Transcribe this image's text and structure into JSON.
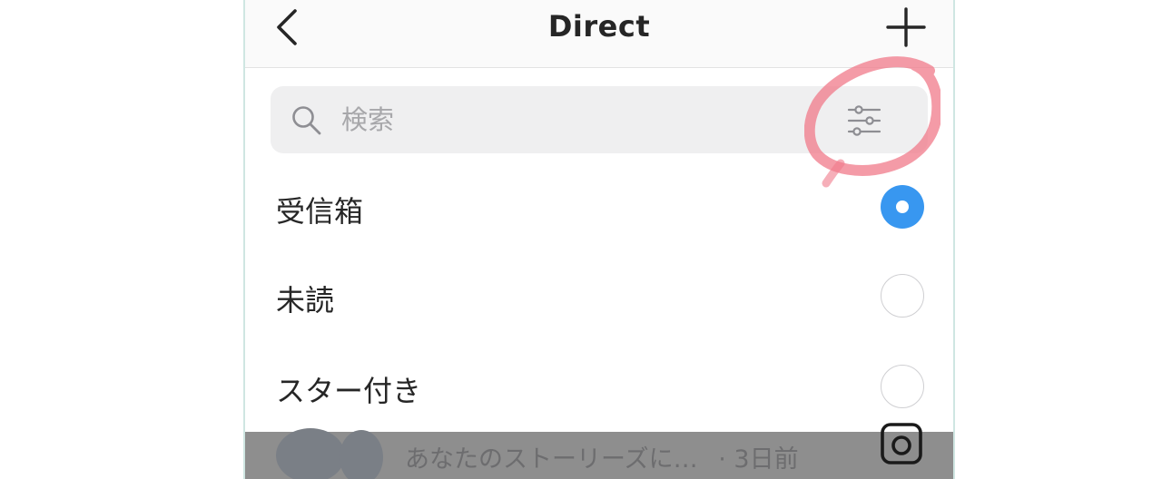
{
  "header": {
    "title": "Direct",
    "back_icon": "chevron-left-icon",
    "new_icon": "plus-icon"
  },
  "search": {
    "placeholder": "検索",
    "value": "",
    "search_icon": "search-icon",
    "filter_icon": "filter-sliders-icon"
  },
  "filters": [
    {
      "label": "受信箱",
      "selected": true
    },
    {
      "label": "未読",
      "selected": false
    },
    {
      "label": "スター付き",
      "selected": false
    }
  ],
  "background_preview": {
    "text": "あなたのストーリーズに…",
    "time": "· 3日前",
    "camera_icon": "camera-icon"
  },
  "colors": {
    "accent": "#3897f0",
    "highlight": "#f07a8a",
    "dim_overlay": "#8e8e8e"
  }
}
